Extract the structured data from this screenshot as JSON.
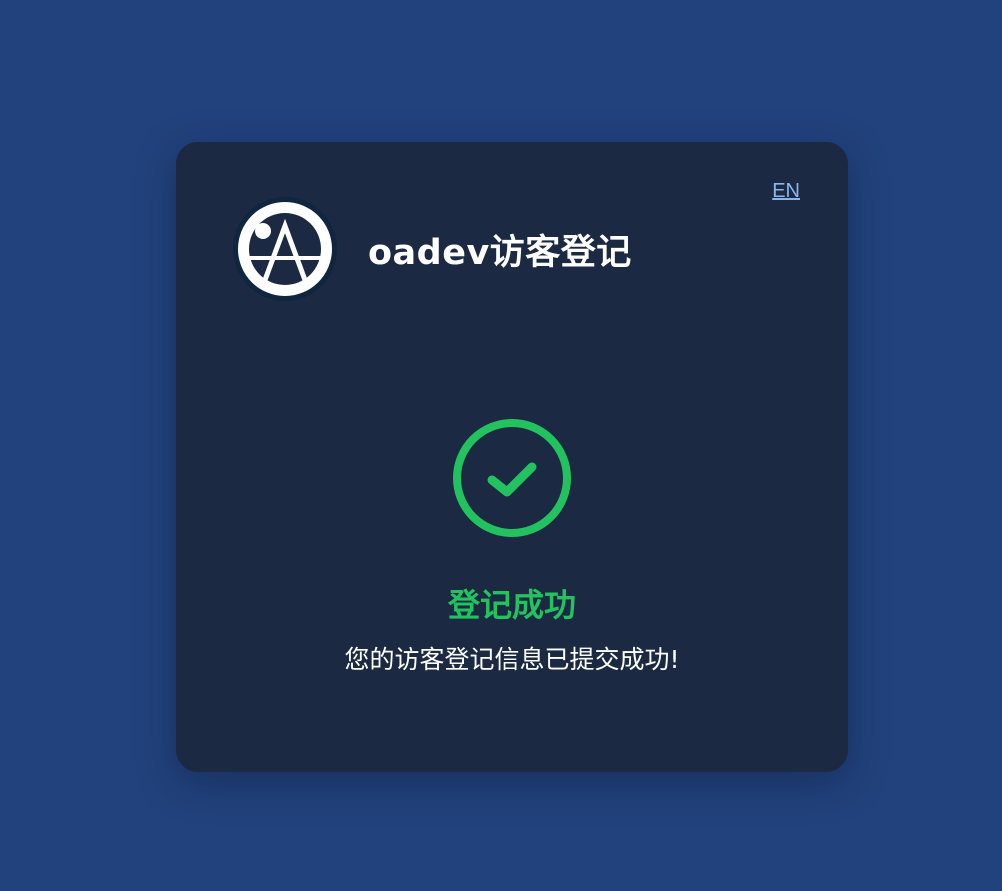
{
  "header": {
    "title": "oadev访客登记",
    "lang_switch": "EN"
  },
  "result": {
    "title": "登记成功",
    "message": "您的访客登记信息已提交成功!"
  },
  "icons": {
    "logo": "oa-logo-icon",
    "success": "check-circle-icon"
  },
  "colors": {
    "page_background": "#22427d",
    "card_background": "#1b2943",
    "success": "#22c35e",
    "link": "#8ab6ee",
    "text": "#ffffff"
  }
}
